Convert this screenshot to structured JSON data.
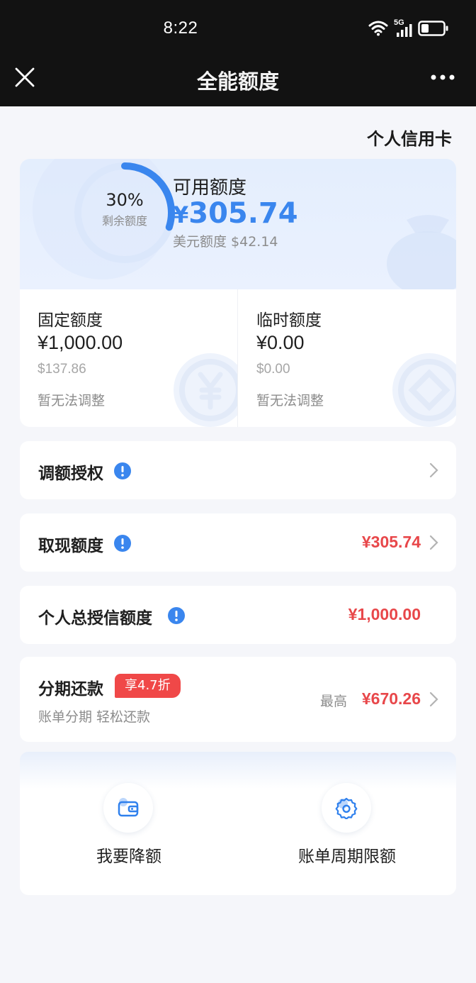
{
  "status_bar": {
    "time": "8:22",
    "network": "5G"
  },
  "nav": {
    "title": "全能额度"
  },
  "card_type": "个人信用卡",
  "credit": {
    "remaining_percent": 30,
    "remaining_percent_text": "30%",
    "remaining_label": "剩余额度",
    "available_label": "可用额度",
    "available_currency": "¥",
    "available_amount": "305.74",
    "usd_line": "美元额度 $42.14"
  },
  "fixed": {
    "label": "固定额度",
    "amount": "¥1,000.00",
    "usd": "$137.86",
    "note": "暂无法调整"
  },
  "temp": {
    "label": "临时额度",
    "amount": "¥0.00",
    "usd": "$0.00",
    "note": "暂无法调整"
  },
  "rows": {
    "adjust_auth": {
      "label": "调额授权"
    },
    "cash": {
      "label": "取现额度",
      "value": "¥305.74"
    },
    "total_credit": {
      "label": "个人总授信额度",
      "value": "¥1,000.00"
    },
    "installment": {
      "label": "分期还款",
      "badge": "享4.7折",
      "sub": "账单分期 轻松还款",
      "max_label": "最高",
      "value": "¥670.26"
    }
  },
  "actions": {
    "reduce": {
      "label": "我要降额",
      "icon": "wallet-icon"
    },
    "cycle": {
      "label": "账单周期限额",
      "icon": "gear-icon"
    }
  },
  "colors": {
    "accent": "#3a86ee",
    "red": "#e8474a",
    "badge": "#f04848"
  }
}
